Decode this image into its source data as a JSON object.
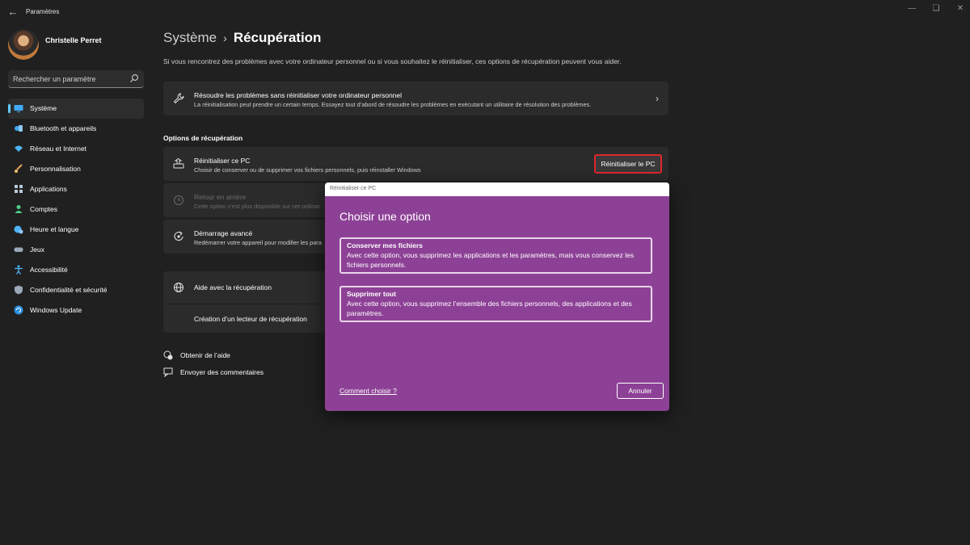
{
  "window": {
    "app_title": "Paramètres"
  },
  "sidebar": {
    "user_name": "Christelle Perret",
    "search_placeholder": "Rechercher un paramètre",
    "items": [
      {
        "label": "Système",
        "icon": "monitor-icon",
        "active": true
      },
      {
        "label": "Bluetooth et appareils",
        "icon": "bluetooth-icon"
      },
      {
        "label": "Réseau et Internet",
        "icon": "wifi-icon"
      },
      {
        "label": "Personnalisation",
        "icon": "brush-icon"
      },
      {
        "label": "Applications",
        "icon": "apps-icon"
      },
      {
        "label": "Comptes",
        "icon": "person-icon"
      },
      {
        "label": "Heure et langue",
        "icon": "globe-clock-icon"
      },
      {
        "label": "Jeux",
        "icon": "gamepad-icon"
      },
      {
        "label": "Accessibilité",
        "icon": "accessibility-icon"
      },
      {
        "label": "Confidentialité et sécurité",
        "icon": "shield-icon"
      },
      {
        "label": "Windows Update",
        "icon": "update-icon"
      }
    ]
  },
  "main": {
    "breadcrumb_parent": "Système",
    "breadcrumb_current": "Récupération",
    "intro": "Si vous rencontrez des problèmes avec votre ordinateur personnel ou si vous souhaitez le réinitialiser, ces options de récupération peuvent vous aider.",
    "troubleshoot": {
      "title": "Résoudre les problèmes sans réinitialiser votre ordinateur personnel",
      "desc": "La réinitialisation peut prendre un certain temps. Essayez tout d’abord de résoudre les problèmes en exécutant un utilitaire de résolution des problèmes."
    },
    "section_title": "Options de récupération",
    "reset": {
      "title": "Réinitialiser ce PC",
      "desc": "Choisir de conserver ou de supprimer vos fichiers personnels, puis réinstaller Windows",
      "button": "Réinitialiser le PC"
    },
    "goback": {
      "title": "Retour en arrière",
      "desc": "Cette option n’est plus disponible sur cet ordinat"
    },
    "advanced": {
      "title": "Démarrage avancé",
      "desc": "Redémarrer votre appareil pour modifier les para"
    },
    "help": {
      "title": "Aide avec la récupération",
      "sub": "Création d’un lecteur de récupération"
    },
    "links": {
      "get_help": "Obtenir de l’aide",
      "feedback": "Envoyer des commentaires"
    }
  },
  "dialog": {
    "bar_title": "Réinitialiser ce PC",
    "heading": "Choisir une option",
    "option1_title": "Conserver mes fichiers",
    "option1_desc": "Avec cette option, vous supprimez les applications et les paramètres, mais vous conservez les fichiers personnels.",
    "option2_title": "Supprimer tout",
    "option2_desc": "Avec cette option, vous supprimez l’ensemble des fichiers personnels, des applications et des paramètres.",
    "help_link": "Comment choisir ?",
    "cancel": "Annuler",
    "bg_color": "#8d4196"
  },
  "colors": {
    "accent": "#60cdff",
    "highlight_border": "#e0262f",
    "background": "#202020",
    "card": "#2b2b2b"
  }
}
